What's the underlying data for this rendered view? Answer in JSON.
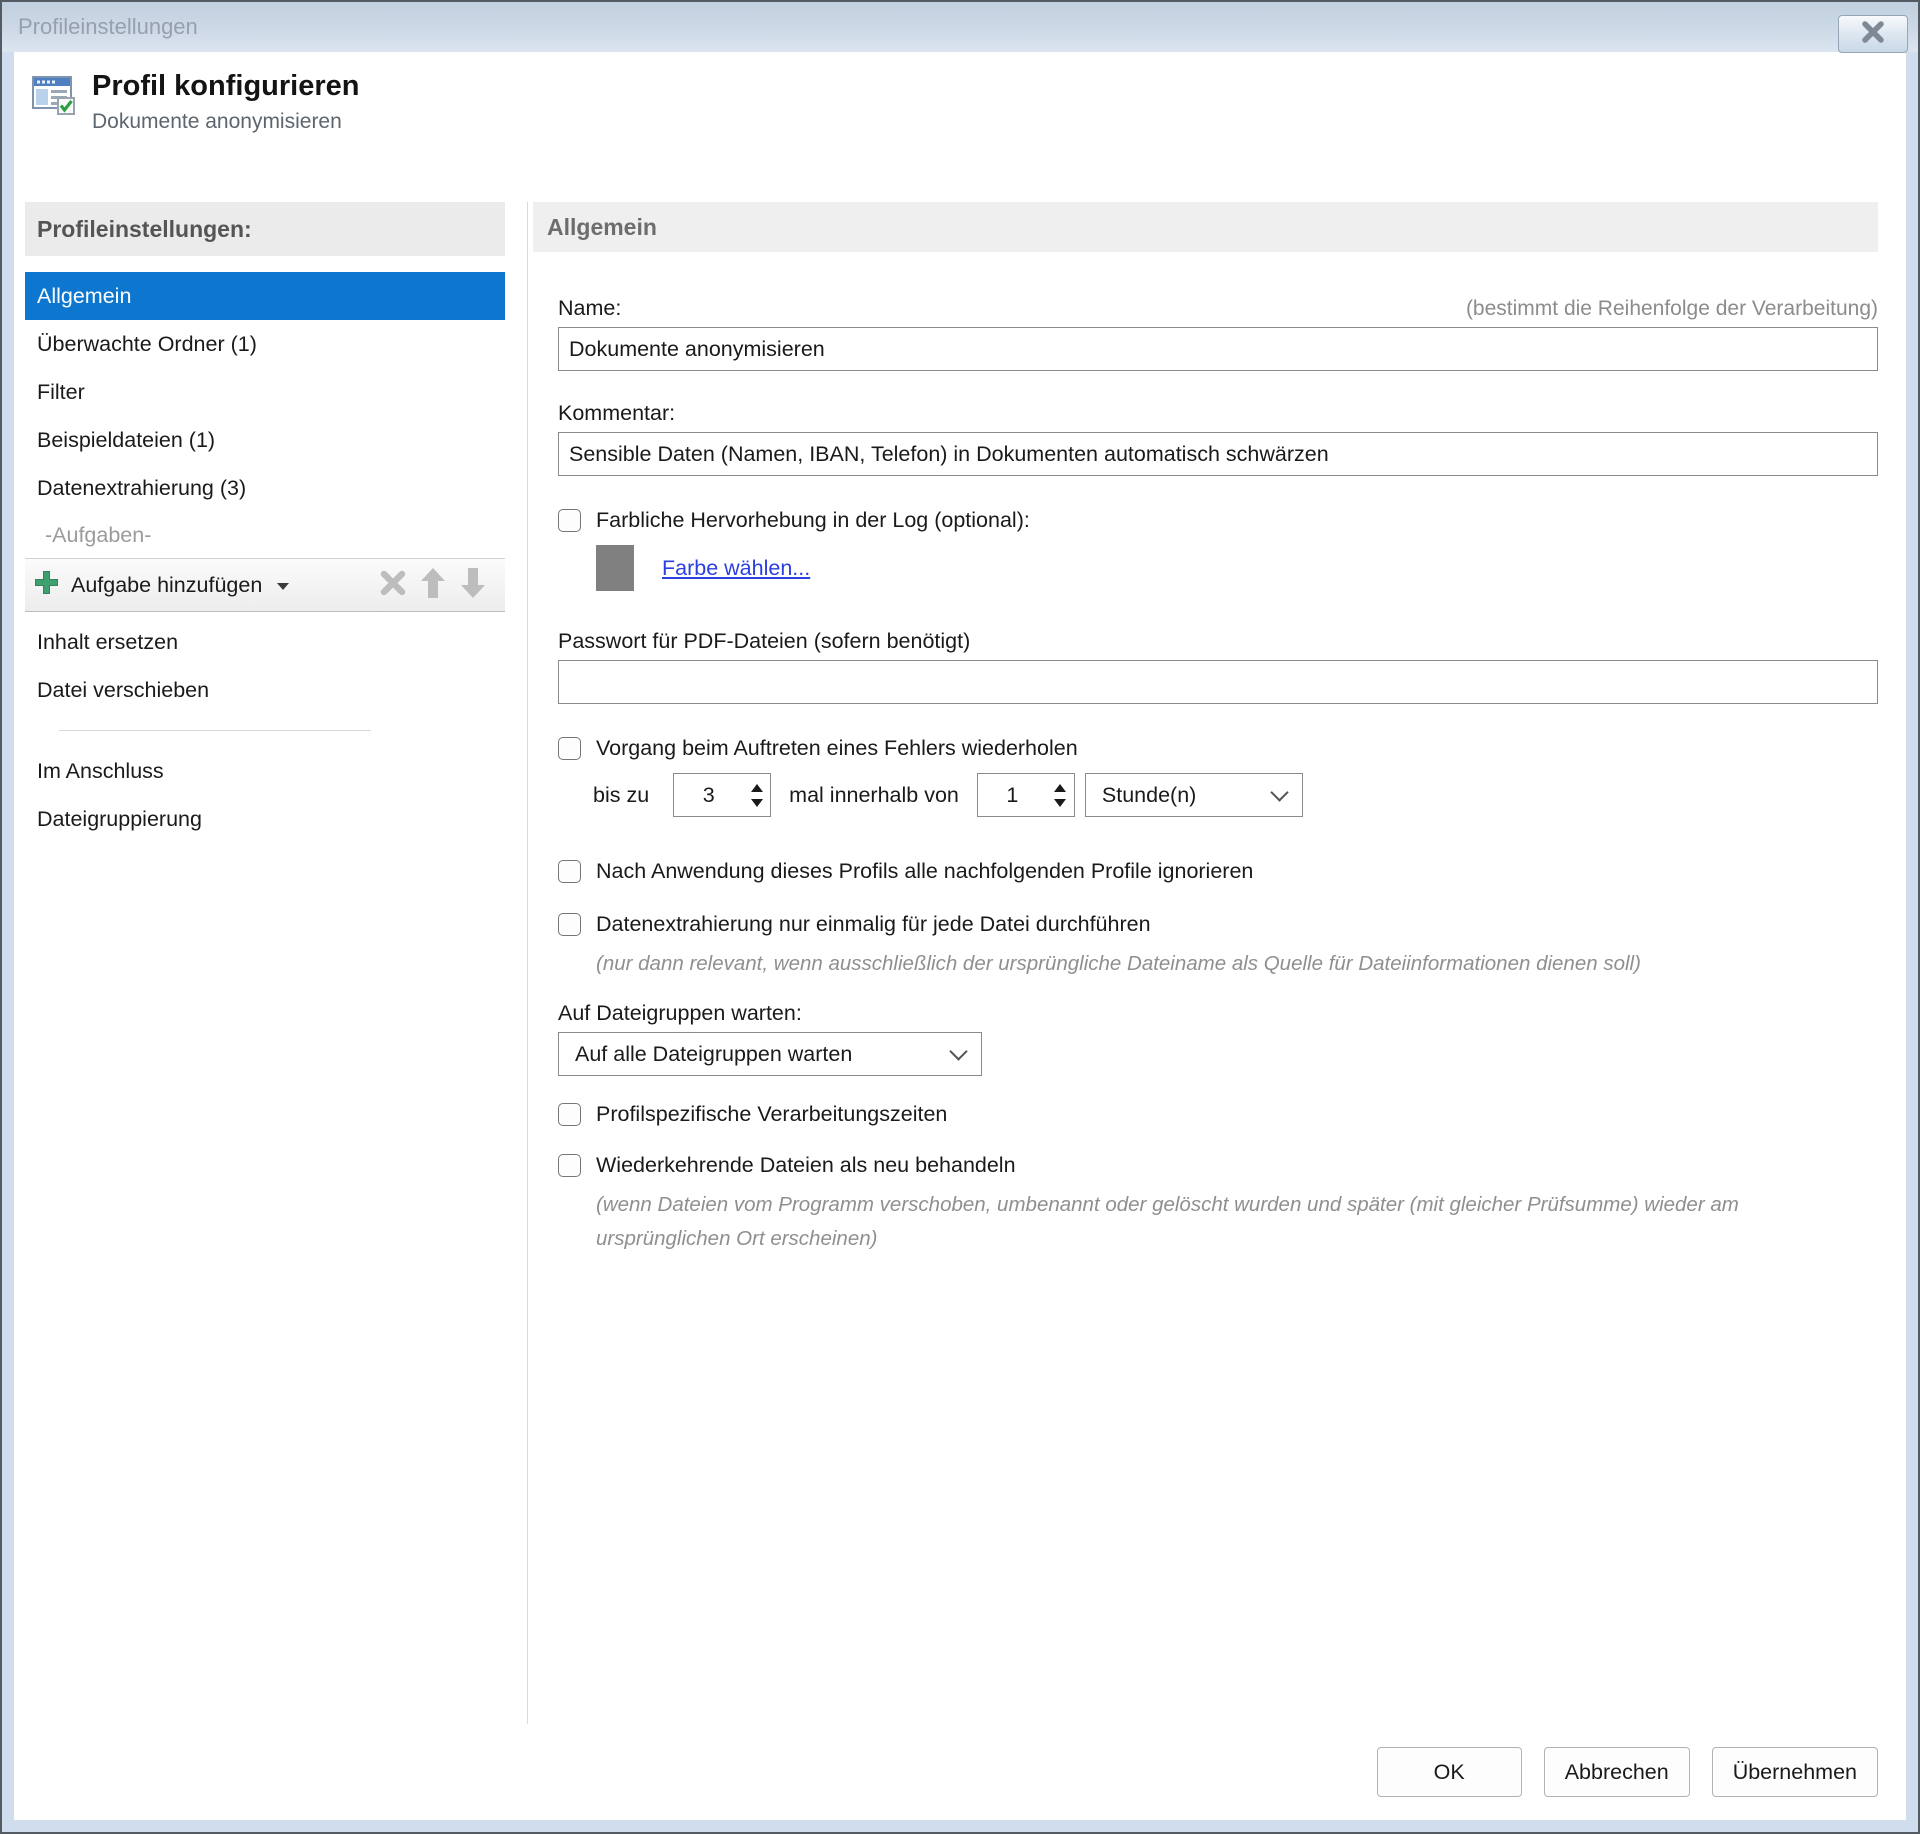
{
  "window": {
    "title": "Profileinstellungen"
  },
  "header": {
    "title": "Profil konfigurieren",
    "subtitle": "Dokumente anonymisieren"
  },
  "sidebar": {
    "header": "Profileinstellungen:",
    "items": [
      {
        "label": "Allgemein",
        "selected": true
      },
      {
        "label": "Überwachte Ordner (1)",
        "selected": false
      },
      {
        "label": "Filter",
        "selected": false
      },
      {
        "label": "Beispieldateien (1)",
        "selected": false
      },
      {
        "label": "Datenextrahierung (3)",
        "selected": false
      }
    ],
    "tasks_group_label": "-Aufgaben-",
    "toolbar": {
      "add_task_label": "Aufgabe hinzufügen"
    },
    "task_items": [
      {
        "label": "Inhalt ersetzen"
      },
      {
        "label": "Datei verschieben"
      }
    ],
    "bottom_items": [
      {
        "label": "Im Anschluss"
      },
      {
        "label": "Dateigruppierung"
      }
    ]
  },
  "main": {
    "heading": "Allgemein",
    "name": {
      "label": "Name:",
      "hint": "(bestimmt die Reihenfolge der Verarbeitung)",
      "value": "Dokumente anonymisieren"
    },
    "comment": {
      "label": "Kommentar:",
      "value": "Sensible Daten (Namen, IBAN, Telefon) in Dokumenten automatisch schwärzen"
    },
    "log_highlight": {
      "label": "Farbliche Hervorhebung in der Log (optional):",
      "checked": false,
      "swatch_color": "#808080",
      "link_label": "Farbe wählen..."
    },
    "pdf_password": {
      "label": "Passwort für PDF-Dateien (sofern benötigt)",
      "value": ""
    },
    "retry": {
      "label": "Vorgang beim Auftreten eines Fehlers wiederholen",
      "checked": false,
      "prefix_label": "bis zu",
      "count_value": "3",
      "middle_label": "mal innerhalb von",
      "interval_value": "1",
      "unit_value": "Stunde(n)"
    },
    "ignore_following": {
      "label": "Nach Anwendung dieses Profils alle nachfolgenden Profile ignorieren",
      "checked": false
    },
    "extract_once": {
      "label": "Datenextrahierung nur einmalig für jede Datei durchführen",
      "checked": false,
      "note": "(nur dann relevant, wenn ausschließlich der ursprüngliche Dateiname als Quelle für Dateiinformationen dienen soll)"
    },
    "file_groups": {
      "label": "Auf Dateigruppen warten:",
      "value": "Auf alle Dateigruppen warten"
    },
    "profile_times": {
      "label": "Profilspezifische Verarbeitungszeiten",
      "checked": false
    },
    "recurring": {
      "label": "Wiederkehrende Dateien als neu behandeln",
      "checked": false,
      "note": "(wenn Dateien vom Programm verschoben, umbenannt oder gelöscht wurden und später (mit gleicher Prüfsumme) wieder am ursprünglichen Ort erscheinen)"
    }
  },
  "footer": {
    "ok_label": "OK",
    "cancel_label": "Abbrechen",
    "apply_label": "Übernehmen"
  },
  "colors": {
    "accent_blue": "#0d77d0",
    "link_blue": "#2b3fe0",
    "swatch_gray": "#808080",
    "add_icon_green": "#3fa06f",
    "titlebar_top": "#c1d0df",
    "titlebar_bottom": "#dae5f0"
  }
}
